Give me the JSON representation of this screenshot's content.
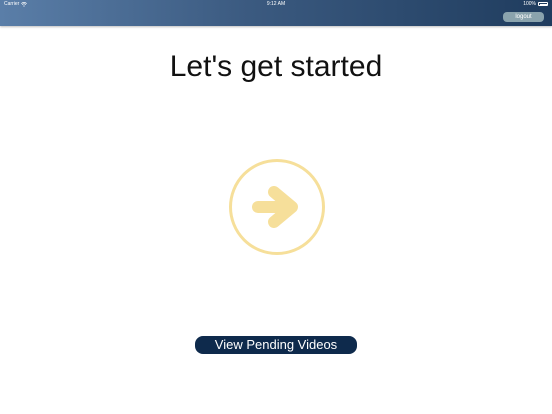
{
  "status_bar": {
    "carrier": "Carrier",
    "time": "9:12 AM",
    "battery": "100%"
  },
  "header": {
    "logout_label": "logout"
  },
  "main": {
    "title": "Let's get started",
    "start_icon": "arrow-right-icon",
    "pending_button_label": "View Pending Videos"
  },
  "colors": {
    "header_gradient_start": "#5a7ea8",
    "header_gradient_end": "#1f3c5e",
    "accent_yellow": "#f6df9a",
    "button_navy": "#0e2a4c",
    "logout_bg": "#8aa3ad"
  }
}
